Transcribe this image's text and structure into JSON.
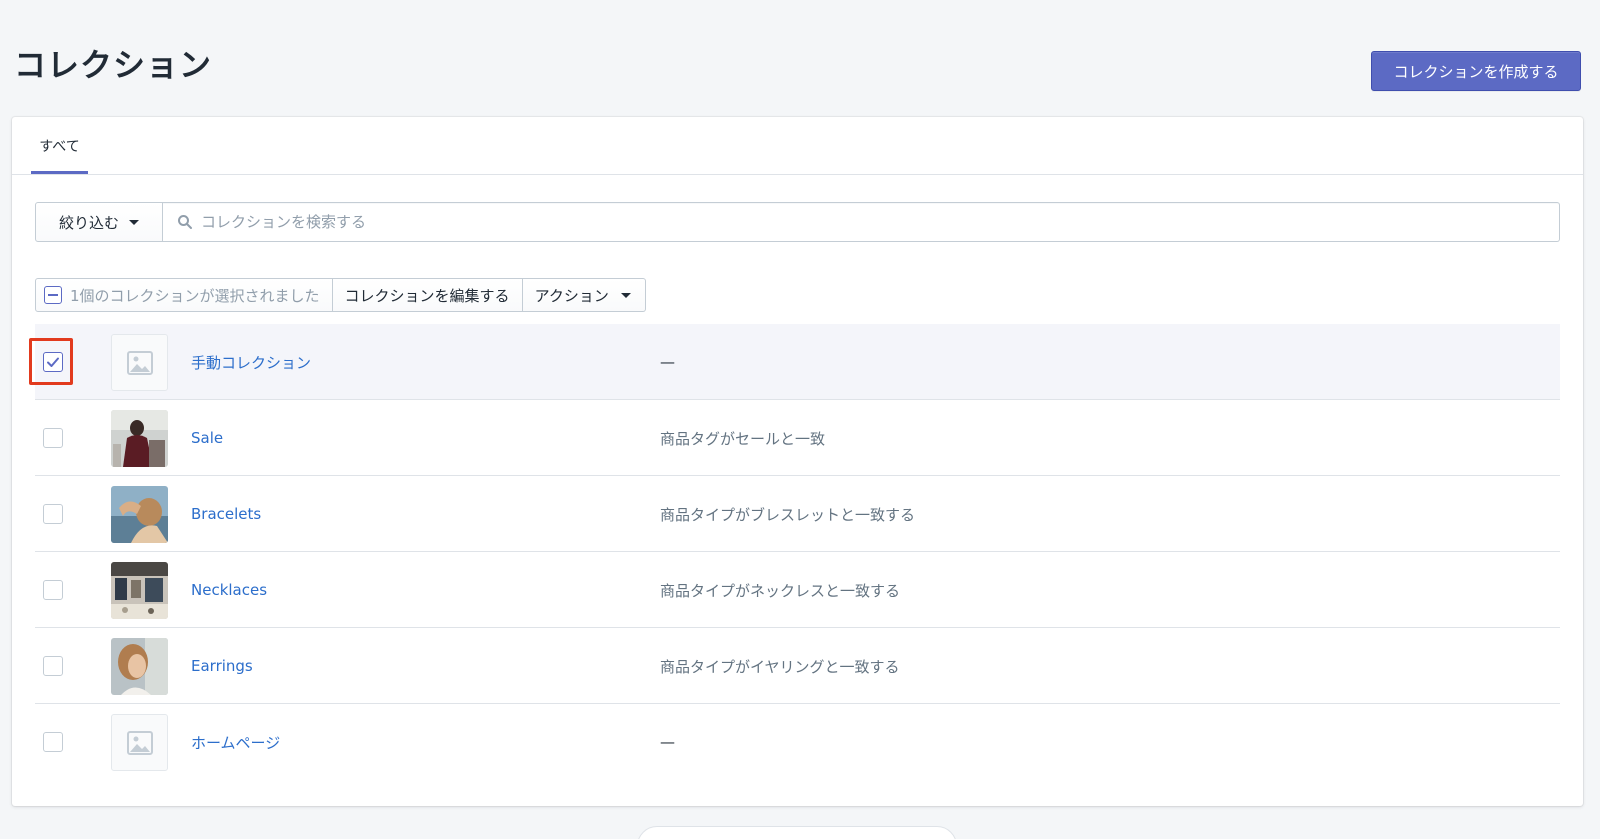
{
  "header": {
    "title": "コレクション",
    "create_button": "コレクションを作成する"
  },
  "tabs": [
    {
      "label": "すべて",
      "active": true
    }
  ],
  "filter": {
    "button_label": "絞り込む",
    "search_placeholder": "コレクションを検索する"
  },
  "bulk_actions": {
    "selected_text": "1個のコレクションが選択されました",
    "edit_label": "コレクションを編集する",
    "actions_label": "アクション"
  },
  "collections": [
    {
      "name": "手動コレクション",
      "condition": "—",
      "selected": true,
      "image": "placeholder-icon"
    },
    {
      "name": "Sale",
      "condition": "商品タグがセールと一致",
      "selected": false,
      "image": "photo-sale"
    },
    {
      "name": "Bracelets",
      "condition": "商品タイプがブレスレットと一致する",
      "selected": false,
      "image": "photo-bracelets"
    },
    {
      "name": "Necklaces",
      "condition": "商品タイプがネックレスと一致する",
      "selected": false,
      "image": "photo-necklaces"
    },
    {
      "name": "Earrings",
      "condition": "商品タイプがイヤリングと一致する",
      "selected": false,
      "image": "photo-earrings"
    },
    {
      "name": "ホームページ",
      "condition": "—",
      "selected": false,
      "image": "placeholder-icon"
    }
  ],
  "colors": {
    "primary": "#5c6ac4",
    "link": "#2c6ecb",
    "highlight": "#e23a1e",
    "selected_row": "#f4f5fa"
  }
}
